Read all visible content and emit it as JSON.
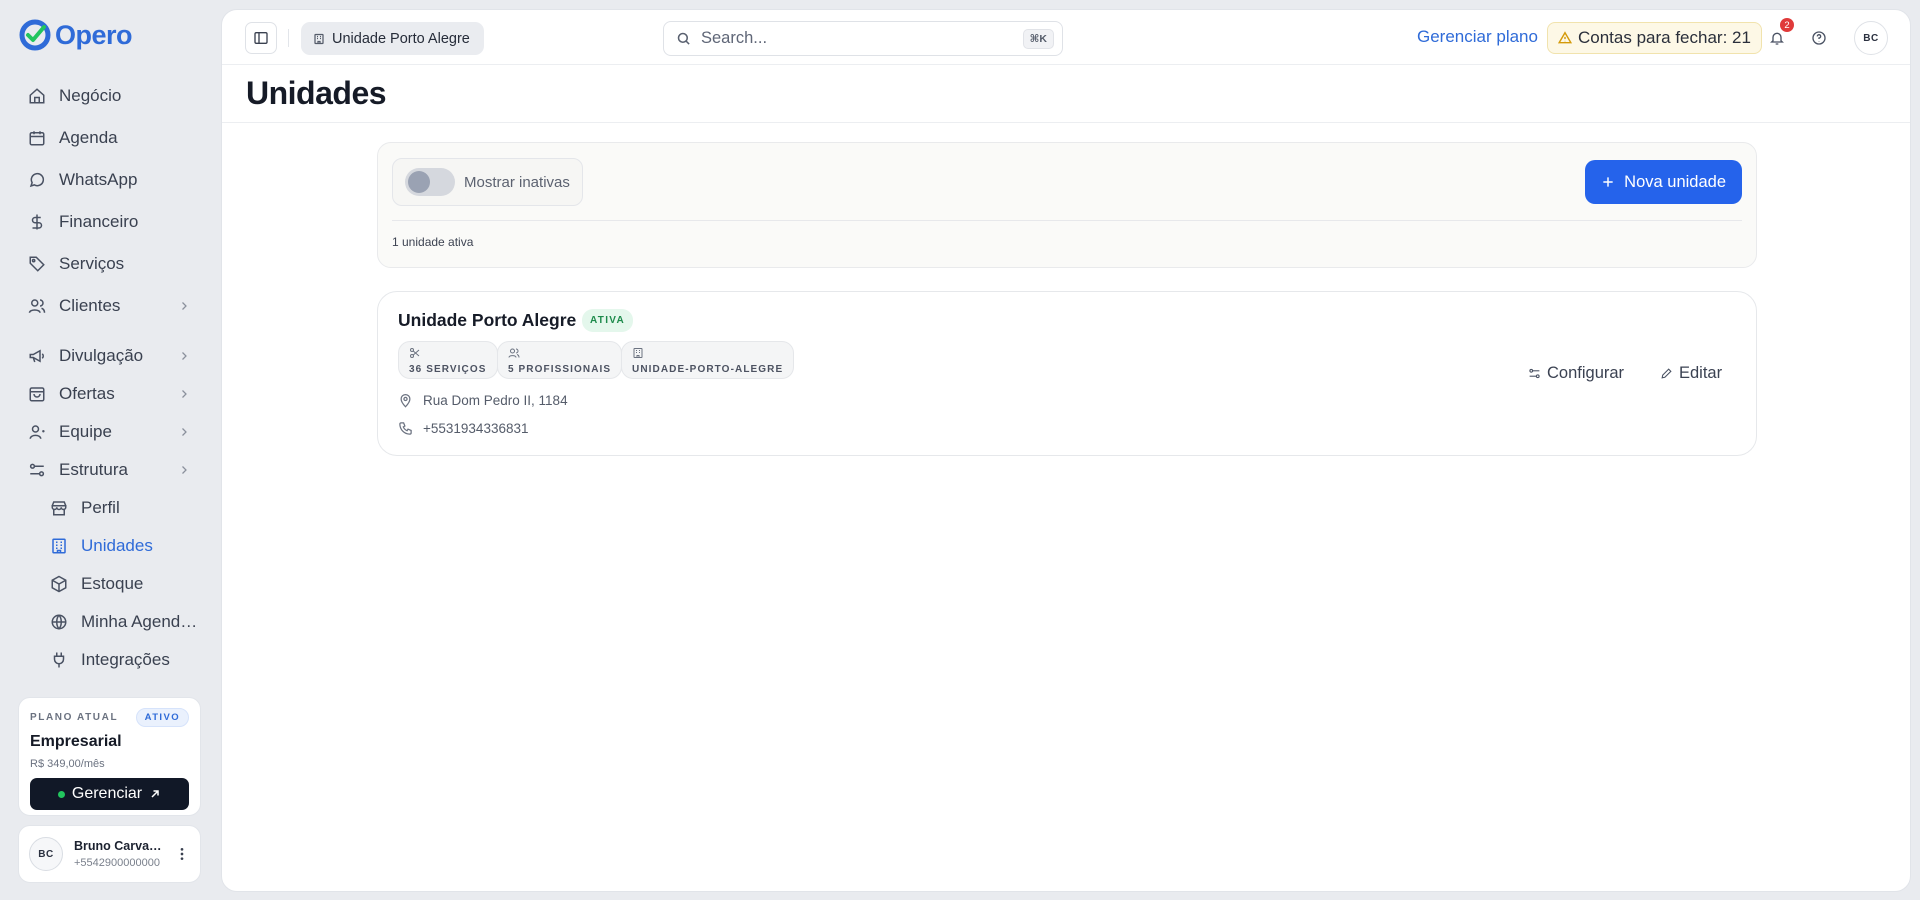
{
  "app": {
    "name": "Opero",
    "brand_color": "#2f6bd8"
  },
  "sidebar": {
    "items": [
      {
        "label": "Negócio",
        "icon": "home-icon",
        "expandable": false
      },
      {
        "label": "Agenda",
        "icon": "calendar-icon",
        "expandable": false
      },
      {
        "label": "WhatsApp",
        "icon": "chat-bubble-icon",
        "expandable": false
      },
      {
        "label": "Financeiro",
        "icon": "dollar-icon",
        "expandable": false
      },
      {
        "label": "Serviços",
        "icon": "tag-icon",
        "expandable": false
      },
      {
        "label": "Clientes",
        "icon": "users-icon",
        "expandable": true
      },
      {
        "label": "Divulgação",
        "icon": "megaphone-icon",
        "expandable": true
      },
      {
        "label": "Ofertas",
        "icon": "shopping-bag-icon",
        "expandable": true
      },
      {
        "label": "Equipe",
        "icon": "team-icon",
        "expandable": true
      },
      {
        "label": "Estrutura",
        "icon": "sliders-icon",
        "expandable": true
      }
    ],
    "sub_items": [
      {
        "label": "Perfil",
        "icon": "store-icon",
        "active": false
      },
      {
        "label": "Unidades",
        "icon": "building-icon",
        "active": true
      },
      {
        "label": "Estoque",
        "icon": "box-icon",
        "active": false
      },
      {
        "label": "Minha Agenda Online",
        "icon": "globe-icon",
        "active": false
      },
      {
        "label": "Integrações",
        "icon": "plug-icon",
        "active": false
      }
    ],
    "plan": {
      "kicker": "PLANO ATUAL",
      "badge": "ATIVO",
      "name": "Empresarial",
      "price": "R$ 349,00/mês",
      "button": "Gerenciar"
    },
    "user": {
      "initials": "BC",
      "name": "Bruno Carvalho",
      "phone": "+5542900000000"
    }
  },
  "topbar": {
    "current_unit": "Unidade Porto Alegre",
    "search_placeholder": "Search...",
    "search_shortcut": "⌘K",
    "manage_plan": "Gerenciar plano",
    "bills_label": "Contas para fechar: 21",
    "notifications_count": "2",
    "user_initials": "BC"
  },
  "page": {
    "title": "Unidades",
    "toggle_label": "Mostrar inativas",
    "toggle_on": false,
    "new_button": "Nova unidade",
    "count_text": "1 unidade ativa"
  },
  "units": [
    {
      "name": "Unidade Porto Alegre",
      "status": "ATIVA",
      "tags": [
        {
          "icon": "scissors-icon",
          "label": "36 SERVIÇOS"
        },
        {
          "icon": "users-icon",
          "label": "5 PROFISSIONAIS"
        },
        {
          "icon": "building-icon",
          "label": "UNIDADE-PORTO-ALEGRE"
        }
      ],
      "address": "Rua Dom Pedro II, 1184",
      "phone": "+5531934336831",
      "actions": {
        "configure": "Configurar",
        "edit": "Editar"
      }
    }
  ]
}
